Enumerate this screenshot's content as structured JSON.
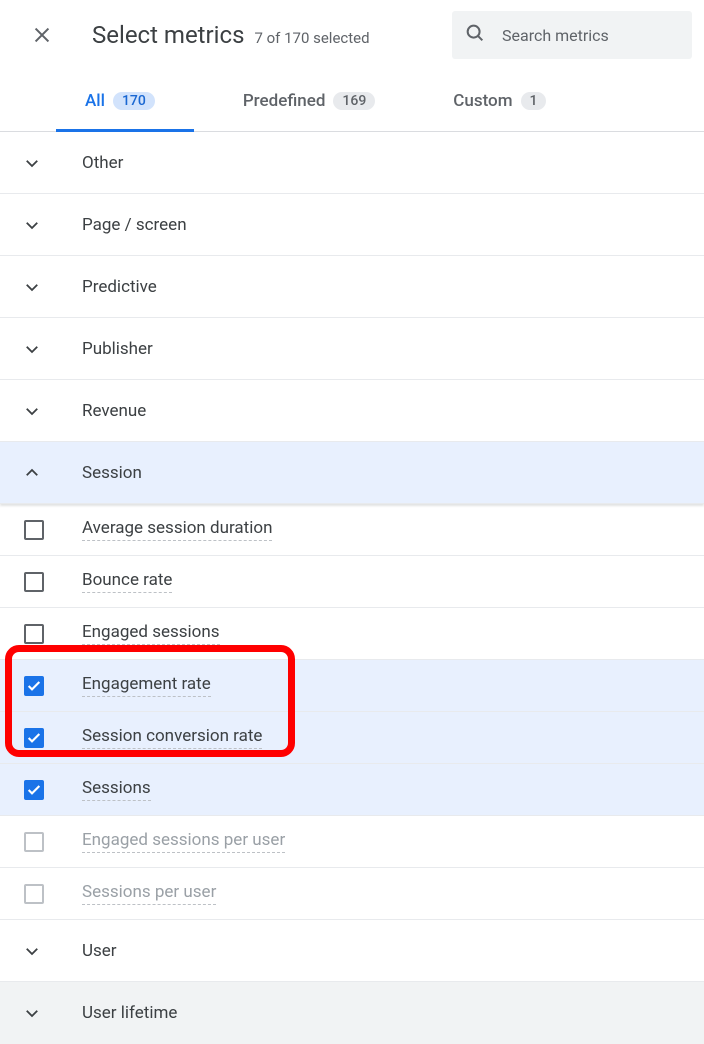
{
  "header": {
    "title": "Select metrics",
    "subtitle": "7 of 170 selected",
    "search_placeholder": "Search metrics"
  },
  "tabs": {
    "all": {
      "label": "All",
      "count": "170"
    },
    "predefined": {
      "label": "Predefined",
      "count": "169"
    },
    "custom": {
      "label": "Custom",
      "count": "1"
    }
  },
  "categories": {
    "other": "Other",
    "page_screen": "Page / screen",
    "predictive": "Predictive",
    "publisher": "Publisher",
    "revenue": "Revenue",
    "session": "Session",
    "user": "User",
    "user_lifetime": "User lifetime"
  },
  "session_metrics": {
    "avg_duration": "Average session duration",
    "bounce_rate": "Bounce rate",
    "engaged_sessions": "Engaged sessions",
    "engagement_rate": "Engagement rate",
    "session_conversion_rate": "Session conversion rate",
    "sessions": "Sessions",
    "engaged_sessions_per_user": "Engaged sessions per user",
    "sessions_per_user": "Sessions per user"
  }
}
